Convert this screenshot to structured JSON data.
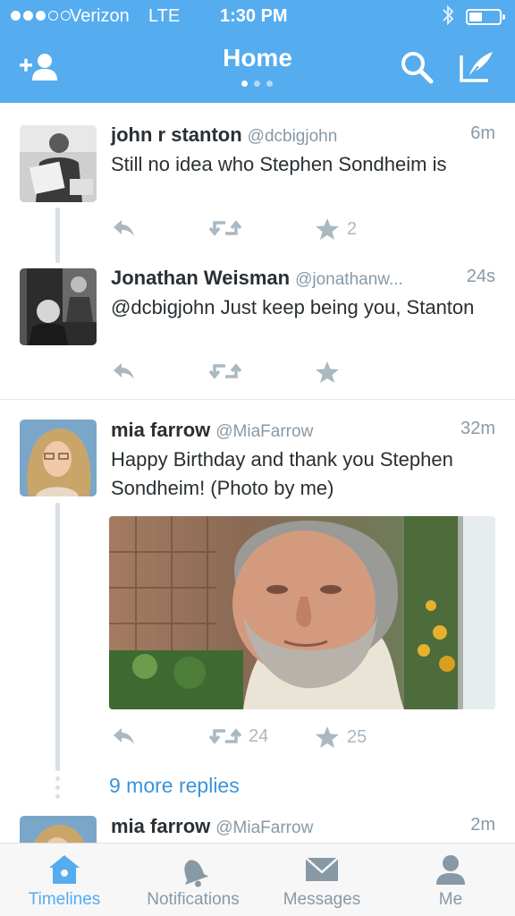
{
  "status_bar": {
    "carrier": "Verizon",
    "network": "LTE",
    "time": "1:30 PM"
  },
  "nav": {
    "title": "Home"
  },
  "colors": {
    "brand": "#55acee",
    "link": "#3b94d9",
    "muted": "#8899a6",
    "icon": "#aab8c2"
  },
  "tweets": [
    {
      "name": "john r stanton",
      "handle": "@dcbigjohn",
      "time": "6m",
      "text": "Still no idea who Stephen Sondheim is",
      "retweets": "",
      "favorites": "2"
    },
    {
      "name": "Jonathan Weisman",
      "handle": "@jonathanw...",
      "time": "24s",
      "text": "@dcbigjohn Just keep being you, Stanton",
      "retweets": "",
      "favorites": ""
    },
    {
      "name": "mia farrow",
      "handle": "@MiaFarrow",
      "time": "32m",
      "text": "Happy Birthday and thank you Stephen Sondheim!  (Photo by me)",
      "retweets": "24",
      "favorites": "25"
    },
    {
      "name": "mia farrow",
      "handle": "@MiaFarrow",
      "time": "2m"
    }
  ],
  "more_replies": "9 more replies",
  "tabs": [
    {
      "label": "Timelines",
      "icon": "home-icon",
      "active": true
    },
    {
      "label": "Notifications",
      "icon": "bell-icon",
      "active": false
    },
    {
      "label": "Messages",
      "icon": "envelope-icon",
      "active": false
    },
    {
      "label": "Me",
      "icon": "person-icon",
      "active": false
    }
  ]
}
